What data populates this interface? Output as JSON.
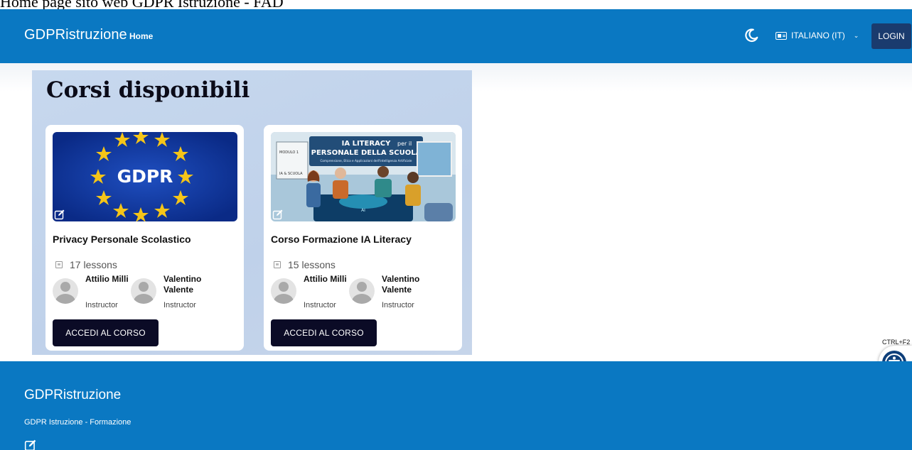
{
  "caption": "Home page sito web GDPR Istruzione - FAD",
  "header": {
    "brand": "GDPRistruzione",
    "nav_home": "Home",
    "theme_icon": "moon-icon",
    "language": "ITALIANO (IT)",
    "login": "LOGIN"
  },
  "section": {
    "title": "Corsi disponibili"
  },
  "courses": [
    {
      "title": "Privacy Personale Scolastico",
      "lessons": "17 lessons",
      "image_text": "GDPR",
      "instructors": [
        {
          "name": "Attilio Milli",
          "role": "Instructor"
        },
        {
          "name": "Valentino Valente",
          "role": "Instructor"
        }
      ],
      "cta": "ACCEDI AL CORSO"
    },
    {
      "title": "Corso Formazione IA Literacy",
      "lessons": "15 lessons",
      "image_text": {
        "title_line1": "IA LITERACY",
        "title_line1_suffix": "per il",
        "title_line2": "PERSONALE DELLA SCUOLA",
        "subtitle": "Comprensione, Etica e Applicazioni dell'Intelligenza Artificiale",
        "board_label": "MODULO 1",
        "board_label2": "IA & SCUOLA",
        "table_label": "AI"
      },
      "instructors": [
        {
          "name": "Attilio Milli",
          "role": "Instructor"
        },
        {
          "name": "Valentino Valente",
          "role": "Instructor"
        }
      ],
      "cta": "ACCEDI AL CORSO"
    }
  ],
  "footer": {
    "brand": "GDPRistruzione",
    "subtitle": "GDPR Istruzione - Formazione"
  },
  "accessibility": {
    "shortcut": "CTRL+F2",
    "icon": "accessibility-icon"
  },
  "colors": {
    "primary": "#0a78c2",
    "login_bg": "#1a3b6e",
    "cta_bg": "#0b0b26",
    "eu_blue": "#0b2f8f",
    "eu_star": "#f5c518"
  }
}
